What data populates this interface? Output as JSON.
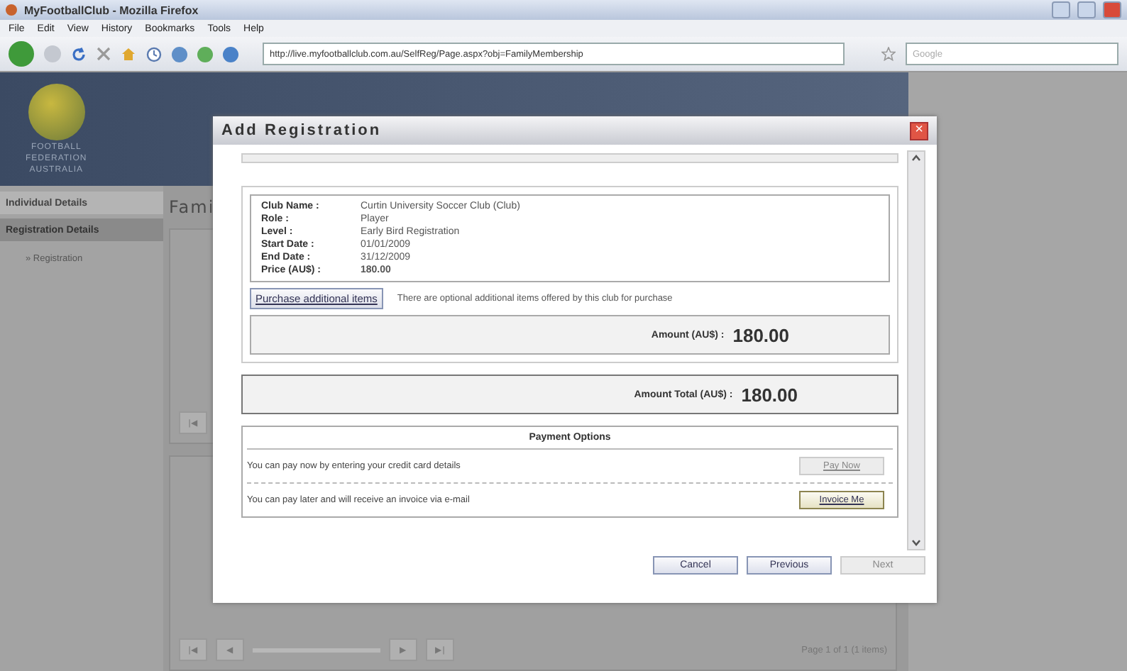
{
  "browser": {
    "title": "MyFootballClub - Mozilla Firefox",
    "menu": [
      "File",
      "Edit",
      "View",
      "History",
      "Bookmarks",
      "Tools",
      "Help"
    ],
    "url": "http://live.myfootballclub.com.au/SelfReg/Page.aspx?obj=FamilyMembership",
    "search_placeholder": "Google"
  },
  "page": {
    "logo_lines": [
      "FOOTBALL",
      "FEDERATION",
      "AUSTRALIA"
    ],
    "sidebar": [
      {
        "label": "Individual Details",
        "selected": false
      },
      {
        "label": "Registration Details",
        "selected": true
      }
    ],
    "sidebar_sub": "» Registration",
    "heading": "Fami",
    "pager_text": "Page 1 of 1 (1 items)",
    "pager_buttons": [
      "|◀",
      "◀",
      "▶",
      "▶|"
    ],
    "top_pager_button": "|◀"
  },
  "dialog": {
    "title": "Add Registration",
    "close": "×",
    "details": [
      {
        "label": "Club Name :",
        "value": "Curtin University Soccer Club (Club)",
        "bold": false
      },
      {
        "label": "Role :",
        "value": "Player",
        "bold": false
      },
      {
        "label": "Level :",
        "value": "Early Bird Registration",
        "bold": false
      },
      {
        "label": "Start Date :",
        "value": "01/01/2009",
        "bold": false
      },
      {
        "label": "End Date :",
        "value": "31/12/2009",
        "bold": false
      },
      {
        "label": "Price (AU$) :",
        "value": "180.00",
        "bold": true
      }
    ],
    "purchase_button": "Purchase additional items",
    "purchase_note": "There are optional additional items offered by this club for purchase",
    "amount_label": "Amount (AU$) :",
    "amount": "180.00",
    "total_label": "Amount Total (AU$) :",
    "total": "180.00",
    "payment_title": "Payment Options",
    "payment_options": [
      {
        "text": "You can pay now by entering your credit card details",
        "button": "Pay Now",
        "disabled": true
      },
      {
        "text": "You can pay later and will receive an invoice via e-mail",
        "button": "Invoice Me",
        "disabled": false
      }
    ],
    "footer_buttons": [
      {
        "label": "Cancel",
        "disabled": false
      },
      {
        "label": "Previous",
        "disabled": false
      },
      {
        "label": "Next",
        "disabled": true
      }
    ]
  }
}
